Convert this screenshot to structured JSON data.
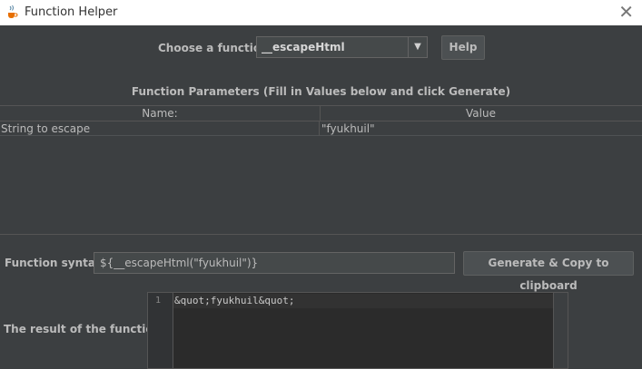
{
  "window": {
    "title": "Function Helper",
    "icon": "java-cup-icon",
    "close_glyph": "✕"
  },
  "chooser": {
    "label": "Choose a function",
    "selected": "__escapeHtml",
    "arrow_glyph": "▼",
    "help_label": "Help"
  },
  "params": {
    "title": "Function Parameters (Fill in Values below and click Generate)",
    "columns": [
      "Name:",
      "Value"
    ],
    "rows": [
      {
        "name": "String to escape",
        "value": "\"fyukhuil\""
      }
    ]
  },
  "syntax": {
    "label": "Function syntax:",
    "value": "${__escapeHtml(\"fyukhuil\")}",
    "generate_label": "Generate & Copy to clipboard"
  },
  "result": {
    "label": "The result of the function is",
    "line_number": "1",
    "text": "&quot;fyukhuil&quot;"
  }
}
